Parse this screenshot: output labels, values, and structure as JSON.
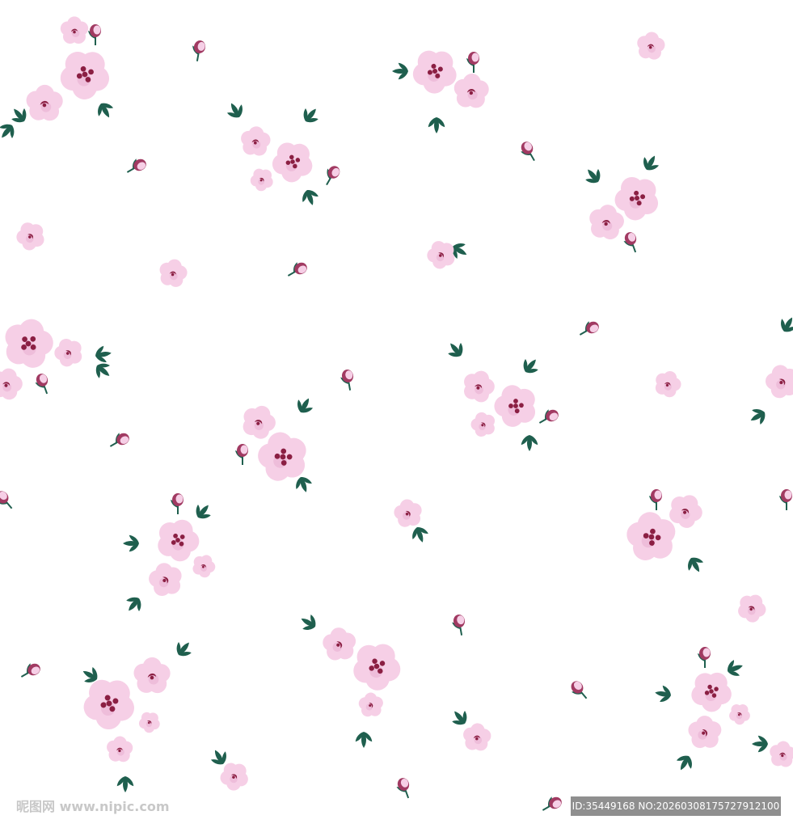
{
  "pattern": {
    "background": "#ffffff",
    "petal_color": "#f6cfe6",
    "petal_shadow": "#eab0d2",
    "center_color": "#8b1f43",
    "bud_color": "#a13a62",
    "leaf_color": "#1f5f4e"
  },
  "watermark": {
    "site_text": "昵图网 www.nipic.com",
    "id_text": "ID:35449168 NO:20260308175727912100"
  }
}
